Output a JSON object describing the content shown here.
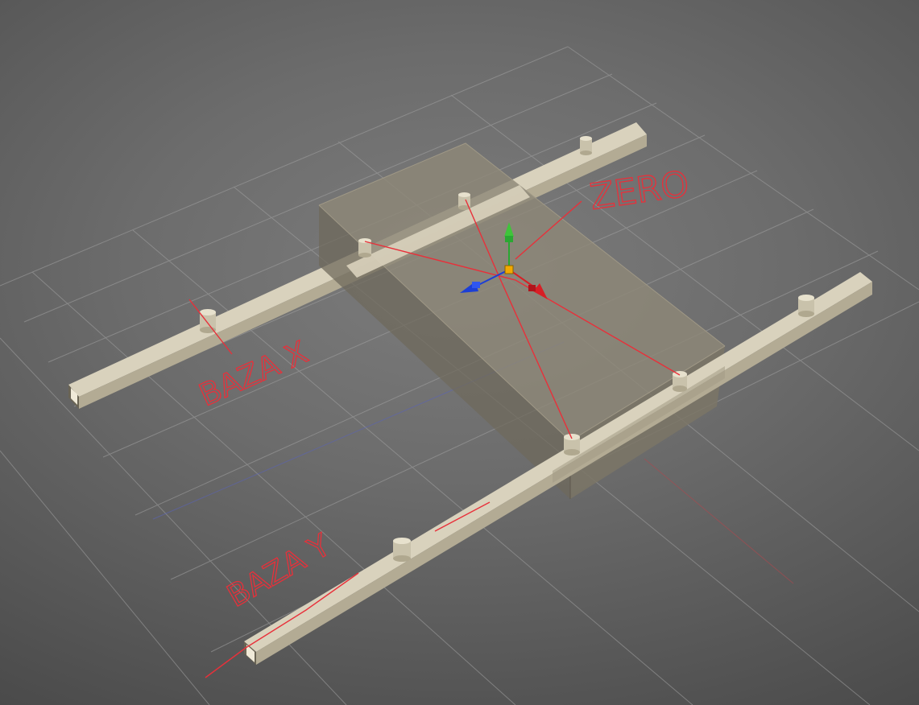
{
  "viewport": {
    "colors": {
      "grid": "#9a9a9a",
      "rail": "#d9d2bd",
      "rail_side": "#b3ab94",
      "rail_end": "#8f876f",
      "box_top": "#8a8474",
      "box_side": "#7b7566",
      "box_front": "#6f6a5c",
      "peg": "#c9c2ab",
      "annotation": "#e8303a",
      "gizmo_x": "#d81f26",
      "gizmo_y": "#2aa832",
      "gizmo_z": "#1c3fd6",
      "gizmo_center": "#f2a900"
    }
  },
  "annotations": {
    "zero_label": "ZERO",
    "baza_x_label": "BAZA X",
    "baza_y_label": "BAZA Y"
  }
}
